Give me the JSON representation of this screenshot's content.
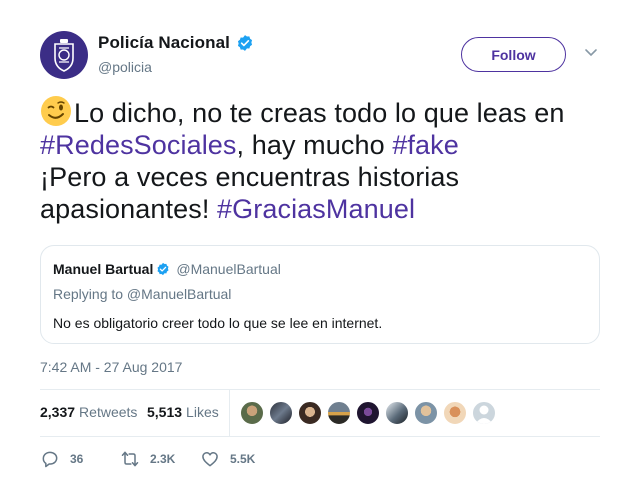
{
  "header": {
    "display_name": "Policía Nacional",
    "handle": "@policia",
    "follow_label": "Follow"
  },
  "tweet": {
    "line1_text": "Lo dicho, no te creas todo lo que leas en",
    "line2_hashtag1": "#RedesSociales",
    "line2_text": ", hay mucho ",
    "line2_hashtag2": "#fake",
    "line3_text": "¡Pero a veces encuentras historias",
    "line4_text": "apasionantes! ",
    "line4_hashtag": "#GraciasManuel"
  },
  "quoted": {
    "name": "Manuel Bartual",
    "handle": "@ManuelBartual",
    "reply_to": "Replying to @ManuelBartual",
    "text": "No es obligatorio creer todo lo que se lee en internet."
  },
  "timestamp": "7:42 AM - 27 Aug 2017",
  "stats": {
    "retweets_count": "2,337",
    "retweets_label": "Retweets",
    "likes_count": "5,513",
    "likes_label": "Likes"
  },
  "actions": {
    "reply_count": "36",
    "retweet_count": "2.3K",
    "like_count": "5.5K"
  },
  "colors": {
    "accent": "#4e33a0",
    "verified": "#1da1f2",
    "secondary_text": "#657786"
  }
}
